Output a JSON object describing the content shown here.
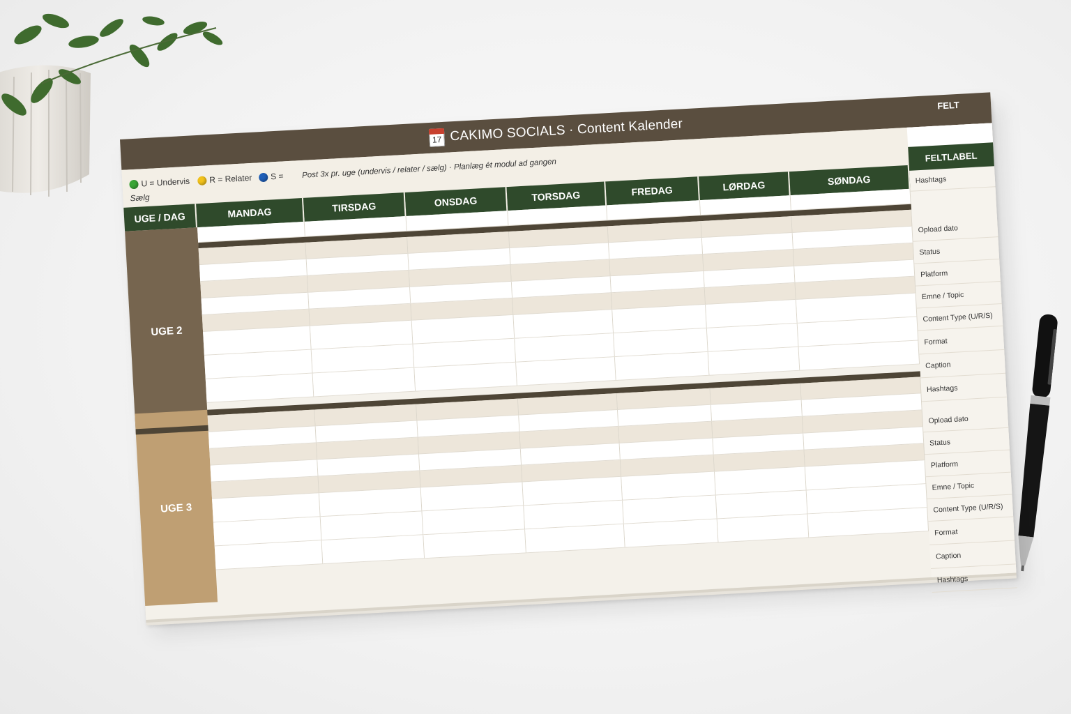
{
  "calendar": {
    "title": "CAKIMO SOCIALS · Content Kalender",
    "calendar_icon_number": "17",
    "felt_header": "FELT",
    "feltlabel_header": "FELTLABEL",
    "legend": {
      "u": "U = Undervis",
      "r": "R = Relater",
      "s": "S =",
      "s_wrap": "Sælg",
      "note": "Post 3x pr. uge (undervis / relater / sælg) · Planlæg ét modul ad gangen",
      "colors": {
        "u": "#3aa535",
        "r": "#f2c21b",
        "s": "#1f5fb8"
      }
    },
    "columns": [
      "UGE / DAG",
      "MANDAG",
      "TIRSDAG",
      "ONSDAG",
      "TORSDAG",
      "FREDAG",
      "LØRDAG",
      "SØNDAG"
    ],
    "weeks": [
      {
        "label": "UGE 2",
        "color": "#76654f"
      },
      {
        "label": "UGE 3",
        "color": "#bf9f73"
      }
    ],
    "top_field": "Hashtags",
    "field_labels": [
      "Opload dato",
      "Status",
      "Platform",
      "Emne / Topic",
      "Content Type (U/R/S)",
      "Format",
      "Caption",
      "Hashtags"
    ],
    "colors": {
      "header_green": "#2f4a2b",
      "title_brown": "#5a4e3f",
      "stripe": "#ede6da"
    }
  }
}
